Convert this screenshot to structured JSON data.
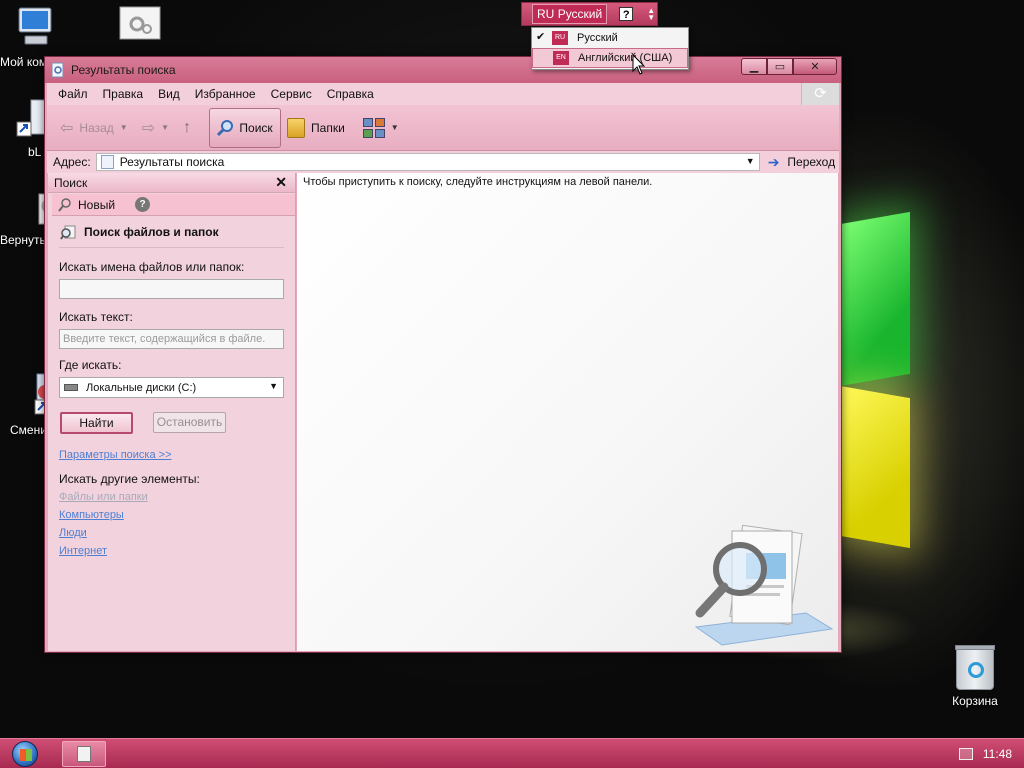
{
  "desktop": {
    "icons": [
      {
        "label": "Мой компьютер"
      },
      {
        "label": ""
      },
      {
        "label": "bL"
      },
      {
        "label": "Вернуть"
      },
      {
        "label": "Смени"
      }
    ],
    "recycle_bin": {
      "label": "Корзина"
    }
  },
  "language_bar": {
    "current_code": "RU",
    "current_label": "Русский",
    "help": "?",
    "menu": [
      {
        "code": "RU",
        "label": "Русский",
        "checked": true
      },
      {
        "code": "EN",
        "label": "Английский (США)",
        "checked": false
      }
    ]
  },
  "window": {
    "title": "Результаты поиска",
    "menu": [
      "Файл",
      "Правка",
      "Вид",
      "Избранное",
      "Сервис",
      "Справка"
    ],
    "toolbar": {
      "back_label": "Назад",
      "search_label": "Поиск",
      "folders_label": "Папки"
    },
    "address": {
      "label": "Адрес:",
      "value": "Результаты поиска",
      "go_label": "Переход"
    },
    "search_panel": {
      "header": "Поиск",
      "new_label": "Новый",
      "help": "?",
      "section_title": "Поиск файлов и папок",
      "filename_label": "Искать имена файлов или папок:",
      "filename_value": "",
      "text_label": "Искать текст:",
      "text_placeholder": "Введите текст, содержащийся в файле.",
      "location_label": "Где искать:",
      "location_value": "Локальные диски (C:)",
      "find_button": "Найти",
      "stop_button": "Остановить",
      "advanced_link": "Параметры поиска  >>",
      "other_label": "Искать другие элементы:",
      "other_links": [
        {
          "label": "Файлы или папки",
          "disabled": true
        },
        {
          "label": "Компьютеры",
          "disabled": false
        },
        {
          "label": "Люди",
          "disabled": false
        },
        {
          "label": "Интернет",
          "disabled": false
        }
      ]
    },
    "results_hint": "Чтобы приступить к поиску, следуйте инструкциям на левой панели."
  },
  "taskbar": {
    "clock": "11:48"
  },
  "colors": {
    "accent": "#c9607f",
    "taskbar": "#b8355f",
    "link": "#4d7fd2"
  }
}
